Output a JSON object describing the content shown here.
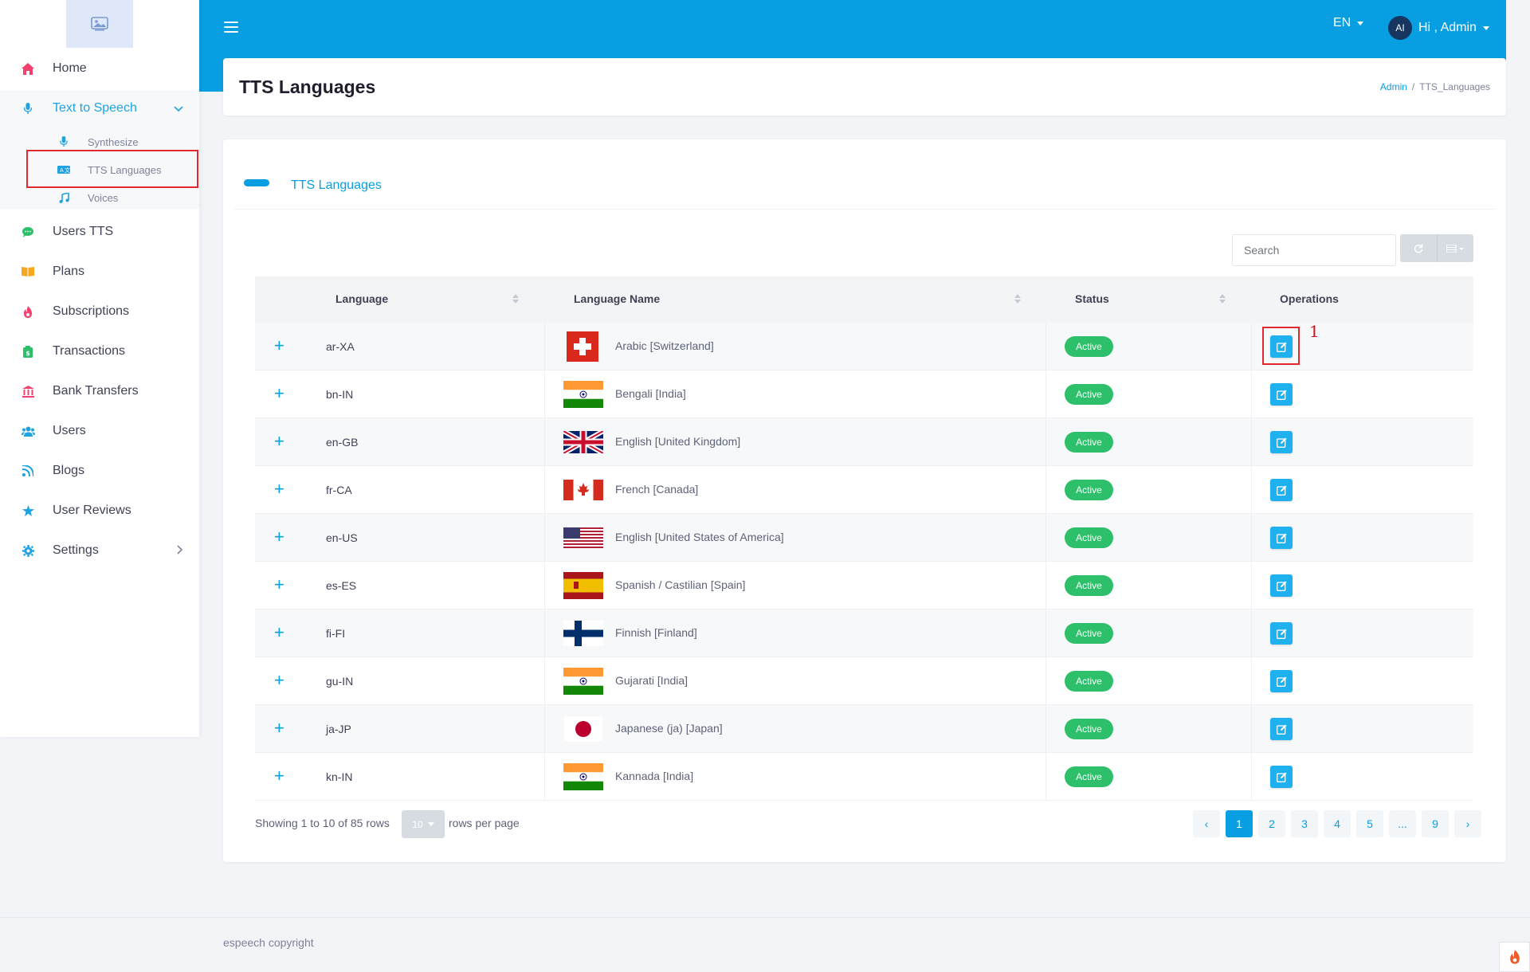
{
  "sidebar": {
    "items": [
      {
        "label": "Home",
        "icon": "home-icon"
      },
      {
        "label": "Text to Speech",
        "icon": "microphone-icon"
      },
      {
        "label": "Users TTS",
        "icon": "chat-icon"
      },
      {
        "label": "Plans",
        "icon": "book-icon"
      },
      {
        "label": "Subscriptions",
        "icon": "fire-icon"
      },
      {
        "label": "Transactions",
        "icon": "wallet-icon"
      },
      {
        "label": "Bank Transfers",
        "icon": "bank-icon"
      },
      {
        "label": "Users",
        "icon": "users-icon"
      },
      {
        "label": "Blogs",
        "icon": "rss-icon"
      },
      {
        "label": "User Reviews",
        "icon": "star-icon"
      },
      {
        "label": "Settings",
        "icon": "gear-icon"
      }
    ],
    "sub_items": [
      {
        "label": "Synthesize",
        "icon": "microphone-icon"
      },
      {
        "label": "TTS Languages",
        "icon": "language-icon"
      },
      {
        "label": "Voices",
        "icon": "music-icon"
      }
    ]
  },
  "header": {
    "language": "EN",
    "avatar_initials": "AI",
    "greeting": "Hi , Admin"
  },
  "page": {
    "title": "TTS Languages",
    "breadcrumb_root": "Admin",
    "breadcrumb_sep": "/",
    "breadcrumb_current": "TTS_Languages"
  },
  "card": {
    "title": "TTS Languages",
    "search_placeholder": "Search"
  },
  "table": {
    "headers": {
      "language": "Language",
      "language_name": "Language Name",
      "status": "Status",
      "operations": "Operations"
    },
    "rows": [
      {
        "code": "ar-XA",
        "name": "Arabic [Switzerland]",
        "flag": "switzerland",
        "status": "Active"
      },
      {
        "code": "bn-IN",
        "name": "Bengali [India]",
        "flag": "india",
        "status": "Active"
      },
      {
        "code": "en-GB",
        "name": "English [United Kingdom]",
        "flag": "uk",
        "status": "Active"
      },
      {
        "code": "fr-CA",
        "name": "French [Canada]",
        "flag": "canada",
        "status": "Active"
      },
      {
        "code": "en-US",
        "name": "English [United States of America]",
        "flag": "usa",
        "status": "Active"
      },
      {
        "code": "es-ES",
        "name": "Spanish / Castilian [Spain]",
        "flag": "spain",
        "status": "Active"
      },
      {
        "code": "fi-FI",
        "name": "Finnish [Finland]",
        "flag": "finland",
        "status": "Active"
      },
      {
        "code": "gu-IN",
        "name": "Gujarati [India]",
        "flag": "india",
        "status": "Active"
      },
      {
        "code": "ja-JP",
        "name": "Japanese (ja) [Japan]",
        "flag": "japan",
        "status": "Active"
      },
      {
        "code": "kn-IN",
        "name": "Kannada [India]",
        "flag": "india",
        "status": "Active"
      }
    ],
    "expand_symbol": "+"
  },
  "pagination": {
    "showing": "Showing 1 to 10 of 85 rows",
    "per_page_value": "10",
    "per_page_label": "rows per page",
    "prev": "‹",
    "next": "›",
    "pages": [
      "1",
      "2",
      "3",
      "4",
      "5",
      "...",
      "9"
    ],
    "active_page": "1"
  },
  "annotation": {
    "label": "1"
  },
  "footer": {
    "copyright": "espeech copyright"
  },
  "colors": {
    "primary": "#079ee2",
    "active_badge": "#2dbf6a",
    "highlight": "#e0282e"
  }
}
